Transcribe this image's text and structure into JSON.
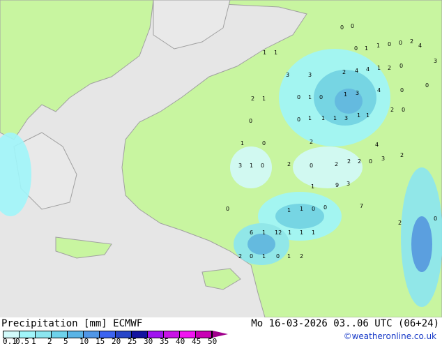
{
  "title": "Precipitation [mm]  ECMWF",
  "datetime": "Mo 16-03-2026 03..06 UTC (06+24)",
  "credit": "©weatheronline.co.uk",
  "colors": {
    "sea": "#e6e6e6",
    "land": "#c8f5a0",
    "border": "#a0a0a0"
  },
  "legend": {
    "ticks": [
      "0.1",
      "0.5",
      "1",
      "2",
      "5",
      "10",
      "15",
      "20",
      "25",
      "30",
      "35",
      "40",
      "45",
      "50"
    ],
    "colors": [
      "#d2fafa",
      "#a0f5fa",
      "#8ce6f0",
      "#6ed2eb",
      "#5ab4e6",
      "#5096e6",
      "#3c64f0",
      "#2846c8",
      "#1414a0",
      "#a014f0",
      "#c814e6",
      "#f014f0",
      "#c800b4"
    ]
  },
  "map_values": [
    "0",
    "0",
    "1",
    "1",
    "0",
    "1",
    "1",
    "0",
    "0",
    "2",
    "4",
    "3",
    "4",
    "4",
    "1",
    "2",
    "0",
    "2",
    "3",
    "3",
    "2",
    "1",
    "0",
    "1",
    "0",
    "1",
    "3",
    "4",
    "0",
    "0",
    "0",
    "1",
    "1",
    "1",
    "3",
    "1",
    "1",
    "0",
    "2",
    "0",
    "1",
    "0",
    "2",
    "2",
    "3",
    "4",
    "3",
    "1",
    "0",
    "2",
    "0",
    "2",
    "2",
    "2",
    "0",
    "9",
    "3",
    "1",
    "0",
    "1",
    "1",
    "0",
    "0",
    "7",
    "6",
    "1",
    "12",
    "1",
    "1",
    "1",
    "2",
    "0",
    "1",
    "0",
    "1",
    "2",
    "2",
    "0"
  ]
}
